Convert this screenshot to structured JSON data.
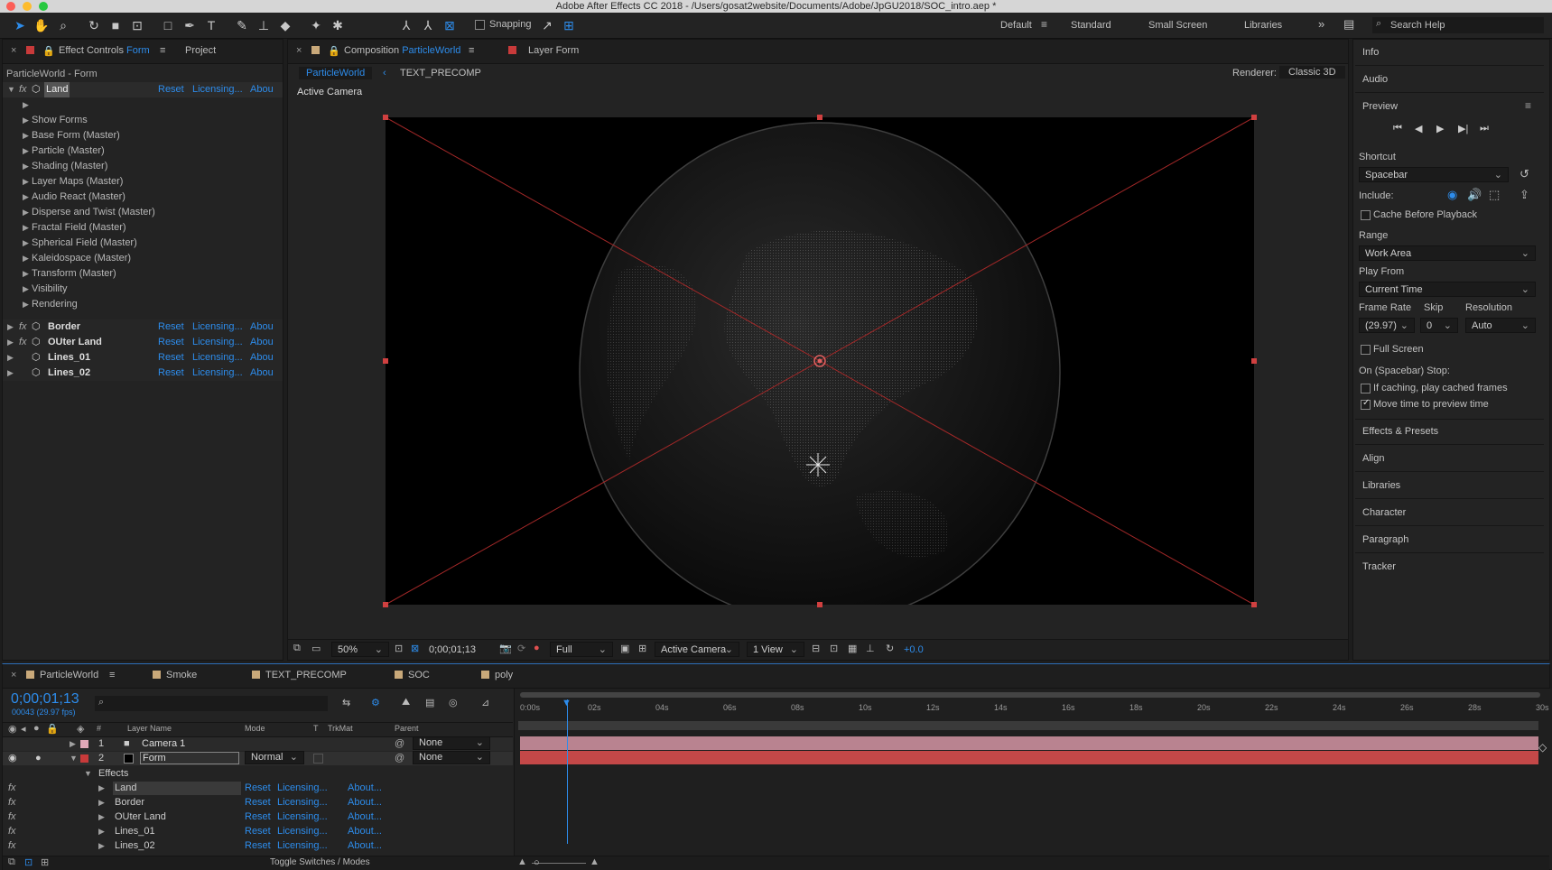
{
  "window": {
    "title": "Adobe After Effects CC 2018 - /Users/gosat2website/Documents/Adobe/JpGU2018/SOC_intro.aep *"
  },
  "toolbar": {
    "snapping_label": "Snapping",
    "workspaces": [
      "Default",
      "Standard",
      "Small Screen",
      "Libraries"
    ],
    "search_placeholder": "Search Help"
  },
  "effect_controls": {
    "tab_prefix": "Effect Controls",
    "tab_layer": "Form",
    "project_tab": "Project",
    "header": "ParticleWorld - Form",
    "effects": [
      {
        "name": "Land",
        "reset": "Reset",
        "licensing": "Licensing...",
        "about": "Abou"
      },
      {
        "name": "Border",
        "reset": "Reset",
        "licensing": "Licensing...",
        "about": "Abou"
      },
      {
        "name": "OUter Land",
        "reset": "Reset",
        "licensing": "Licensing...",
        "about": "Abou"
      },
      {
        "name": "Lines_01",
        "reset": "Reset",
        "licensing": "Licensing...",
        "about": "Abou"
      },
      {
        "name": "Lines_02",
        "reset": "Reset",
        "licensing": "Licensing...",
        "about": "Abou"
      }
    ],
    "land_groups": [
      "Show Forms",
      "Base Form (Master)",
      "Particle (Master)",
      "Shading (Master)",
      "Layer Maps (Master)",
      "Audio React (Master)",
      "Disperse and Twist (Master)",
      "Fractal Field (Master)",
      "Spherical Field (Master)",
      "Kaleidospace (Master)",
      "Transform (Master)",
      "Visibility",
      "Rendering"
    ]
  },
  "composition": {
    "tab_prefix": "Composition",
    "tab_name": "ParticleWorld",
    "layer_tab": "Layer Form",
    "breadcrumbs": [
      "ParticleWorld",
      "TEXT_PRECOMP"
    ],
    "renderer_label": "Renderer:",
    "renderer_value": "Classic 3D",
    "camera_label": "Active Camera",
    "footer": {
      "zoom": "50%",
      "timecode": "0;00;01;13",
      "resolution": "Full",
      "view": "Active Camera",
      "layout": "1 View",
      "exposure": "+0.0"
    }
  },
  "right_panel": {
    "info": "Info",
    "audio": "Audio",
    "preview": "Preview",
    "shortcut_label": "Shortcut",
    "shortcut_value": "Spacebar",
    "include_label": "Include:",
    "cache_label": "Cache Before Playback",
    "range_label": "Range",
    "range_value": "Work Area",
    "play_from_label": "Play From",
    "play_from_value": "Current Time",
    "frame_rate_label": "Frame Rate",
    "skip_label": "Skip",
    "resolution_label": "Resolution",
    "frame_rate_value": "(29.97)",
    "skip_value": "0",
    "resolution_value": "Auto",
    "full_screen_label": "Full Screen",
    "on_stop_label": "On (Spacebar) Stop:",
    "if_caching_label": "If caching, play cached frames",
    "move_time_label": "Move time to preview time",
    "panels": [
      "Effects & Presets",
      "Align",
      "Libraries",
      "Character",
      "Paragraph",
      "Tracker"
    ]
  },
  "timeline": {
    "tabs": [
      "ParticleWorld",
      "Smoke",
      "TEXT_PRECOMP",
      "SOC",
      "poly"
    ],
    "timecode": "0;00;01;13",
    "frame_info": "00043 (29.97 fps)",
    "search_placeholder": "",
    "columns": {
      "num": "#",
      "layer_name": "Layer Name",
      "mode": "Mode",
      "t": "T",
      "trkmat": "TrkMat",
      "parent": "Parent"
    },
    "layers": [
      {
        "num": "1",
        "name": "Camera 1",
        "mode": "",
        "parent": "None"
      },
      {
        "num": "2",
        "name": "Form",
        "mode": "Normal",
        "parent": "None"
      }
    ],
    "effects_label": "Effects",
    "effects": [
      {
        "name": "Land",
        "reset": "Reset",
        "licensing": "Licensing...",
        "about": "About..."
      },
      {
        "name": "Border",
        "reset": "Reset",
        "licensing": "Licensing...",
        "about": "About..."
      },
      {
        "name": "OUter Land",
        "reset": "Reset",
        "licensing": "Licensing...",
        "about": "About..."
      },
      {
        "name": "Lines_01",
        "reset": "Reset",
        "licensing": "Licensing...",
        "about": "About..."
      },
      {
        "name": "Lines_02",
        "reset": "Reset",
        "licensing": "Licensing...",
        "about": "About..."
      }
    ],
    "ruler": [
      "0:00s",
      "02s",
      "04s",
      "06s",
      "08s",
      "10s",
      "12s",
      "14s",
      "16s",
      "18s",
      "20s",
      "22s",
      "24s",
      "26s",
      "28s",
      "30s"
    ],
    "toggle_label": "Toggle Switches / Modes"
  }
}
